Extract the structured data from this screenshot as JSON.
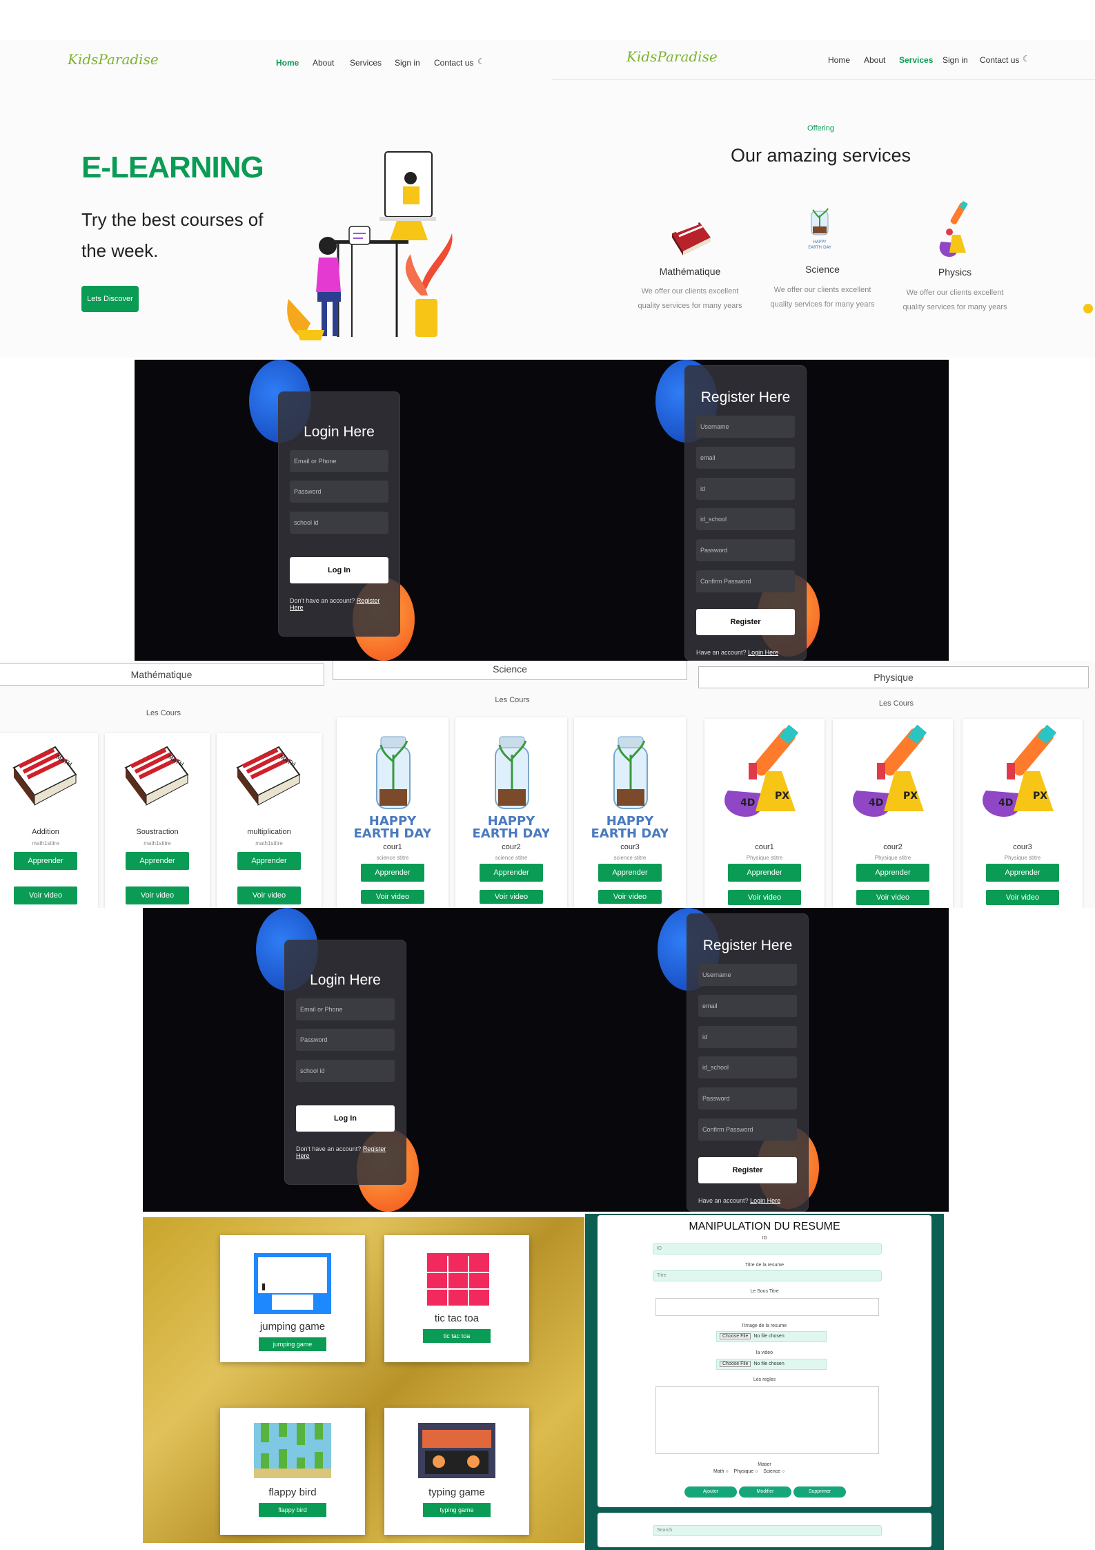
{
  "landing": {
    "logo": "KidsParadise",
    "nav": [
      "Home",
      "About",
      "Services",
      "Sign in",
      "Contact us"
    ],
    "active": "Home",
    "hero_title": "E-LEARNING",
    "hero_line1": "Try the best courses of",
    "hero_line2": "the week.",
    "cta": "Lets Discover"
  },
  "services": {
    "logo": "KidsParadise",
    "nav": [
      "Home",
      "About",
      "Services",
      "Sign in",
      "Contact us"
    ],
    "active": "Services",
    "eyebrow": "Offering",
    "title": "Our amazing services",
    "items": [
      {
        "name": "Mathématique",
        "desc1": "We offer our clients excellent",
        "desc2": "quality services for many years"
      },
      {
        "name": "Science",
        "desc1": "We offer our clients excellent",
        "desc2": "quality services for many years"
      },
      {
        "name": "Physics",
        "desc1": "We offer our clients excellent",
        "desc2": "quality services for many years"
      }
    ]
  },
  "login": {
    "title": "Login Here",
    "fields": [
      "Email or Phone",
      "Password",
      "school id"
    ],
    "button": "Log In",
    "footer_text": "Don't have an account?",
    "footer_link": "Register Here"
  },
  "register": {
    "title": "Register Here",
    "fields": [
      "Username",
      "email",
      "id",
      "id_school",
      "Password",
      "Confirm Password"
    ],
    "button": "Register",
    "footer_text": "Have an account?",
    "footer_link": "Login Here"
  },
  "courses": {
    "sub": "Les Cours",
    "btn_learn": "Apprender",
    "btn_video": "Voir video",
    "math": {
      "title": "Mathématique",
      "cards": [
        {
          "name": "Addition",
          "sub": "math1stitre"
        },
        {
          "name": "Soustraction",
          "sub": "math1stitre"
        },
        {
          "name": "multiplication",
          "sub": "math1stitre"
        }
      ]
    },
    "science": {
      "title": "Science",
      "cards": [
        {
          "name": "cour1",
          "sub": "science stitre"
        },
        {
          "name": "cour2",
          "sub": "science stitre"
        },
        {
          "name": "cour3",
          "sub": "science stitre"
        }
      ]
    },
    "physics": {
      "title": "Physique",
      "cards": [
        {
          "name": "cour1",
          "sub": "Physique stitre"
        },
        {
          "name": "cour2",
          "sub": "Physique stitre"
        },
        {
          "name": "cour3",
          "sub": "Physique stitre"
        }
      ]
    }
  },
  "earth_day": [
    "HAPPY",
    "EARTH DAY"
  ],
  "games": [
    {
      "title": "jumping game",
      "button": "jumping game"
    },
    {
      "title": "tic tac toa",
      "button": "tic tac toa"
    },
    {
      "title": "flappy bird",
      "button": "flappy bird"
    },
    {
      "title": "typing game",
      "button": "typing game"
    }
  ],
  "resume_form": {
    "title": "MANIPULATION DU RESUME",
    "id_label": "ID",
    "id_placeholder": "ID",
    "titre_label": "Titre de la resume",
    "titre_placeholder": "Titre",
    "sous_titre_label": "Le Sous Titre",
    "image_label": "l'image de la resume",
    "video_label": "la video",
    "file_btn": "Choose File",
    "file_none": "No file chosen",
    "regles_label": "Les regles",
    "matier_label": "Matier",
    "options": [
      "Math",
      "Physique",
      "Science"
    ],
    "buttons": [
      "Ajouter",
      "Modifier",
      "Supprimer"
    ],
    "search_placeholder": "Search"
  },
  "colors": {
    "green": "#0a9b55",
    "teal": "#0c5e52",
    "dark_bg": "#07070c",
    "mustard": "#c9a52b"
  }
}
